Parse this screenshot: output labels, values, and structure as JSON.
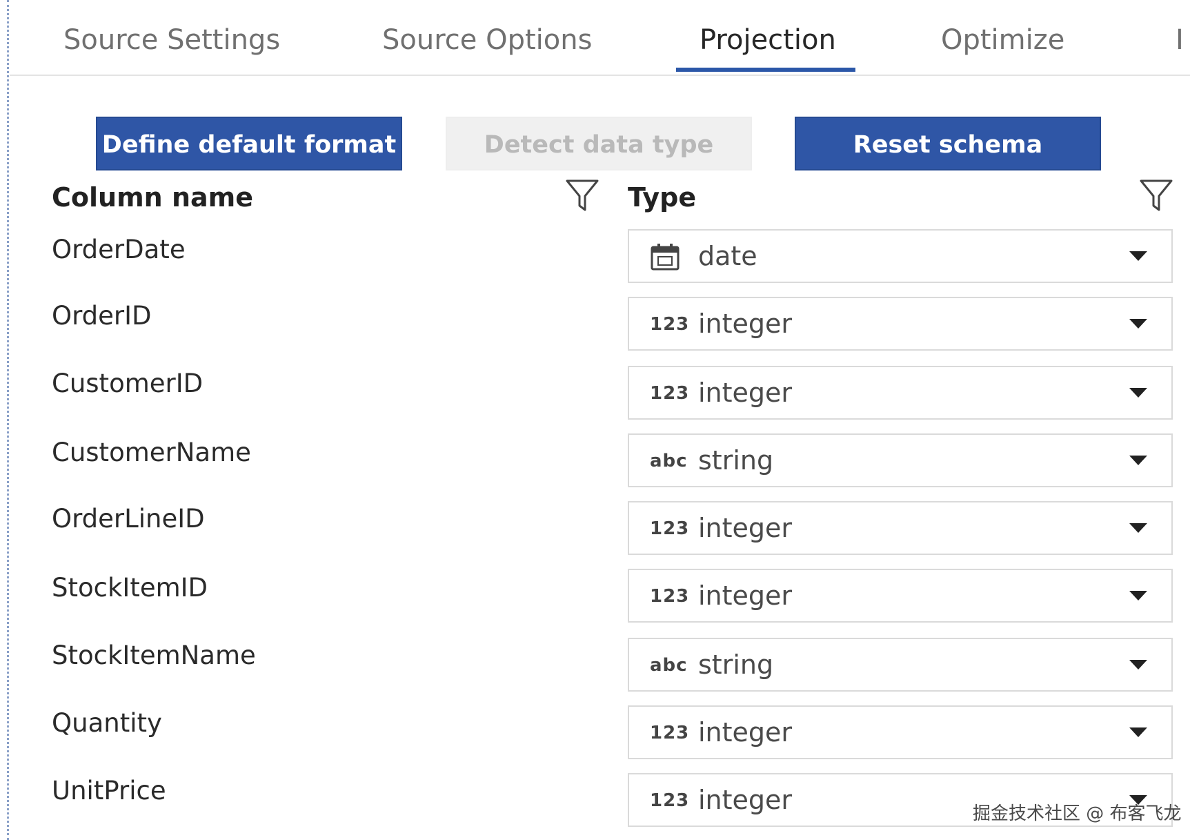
{
  "tabs": [
    {
      "label": "Source Settings",
      "active": false
    },
    {
      "label": "Source Options",
      "active": false
    },
    {
      "label": "Projection",
      "active": true
    },
    {
      "label": "Optimize",
      "active": false
    },
    {
      "label": "I",
      "active": false
    }
  ],
  "toolbar": {
    "define_default_format": "Define default format",
    "detect_data_type": "Detect data type",
    "reset_schema": "Reset schema"
  },
  "headers": {
    "column_name": "Column name",
    "type": "Type"
  },
  "rows": [
    {
      "name": "OrderDate",
      "type": "date",
      "icon": "calendar-icon",
      "icon_text": ""
    },
    {
      "name": "OrderID",
      "type": "integer",
      "icon": "numeric-icon",
      "icon_text": "123"
    },
    {
      "name": "CustomerID",
      "type": "integer",
      "icon": "numeric-icon",
      "icon_text": "123"
    },
    {
      "name": "CustomerName",
      "type": "string",
      "icon": "string-icon",
      "icon_text": "abc"
    },
    {
      "name": "OrderLineID",
      "type": "integer",
      "icon": "numeric-icon",
      "icon_text": "123"
    },
    {
      "name": "StockItemID",
      "type": "integer",
      "icon": "numeric-icon",
      "icon_text": "123"
    },
    {
      "name": "StockItemName",
      "type": "string",
      "icon": "string-icon",
      "icon_text": "abc"
    },
    {
      "name": "Quantity",
      "type": "integer",
      "icon": "numeric-icon",
      "icon_text": "123"
    },
    {
      "name": "UnitPrice",
      "type": "integer",
      "icon": "numeric-icon",
      "icon_text": "123"
    }
  ],
  "watermark": "掘金技术社区 @ 布客飞龙",
  "colors": {
    "accent": "#2f56a6",
    "tab_underline": "#2b57a8",
    "disabled_bg": "#f0f0f0"
  }
}
